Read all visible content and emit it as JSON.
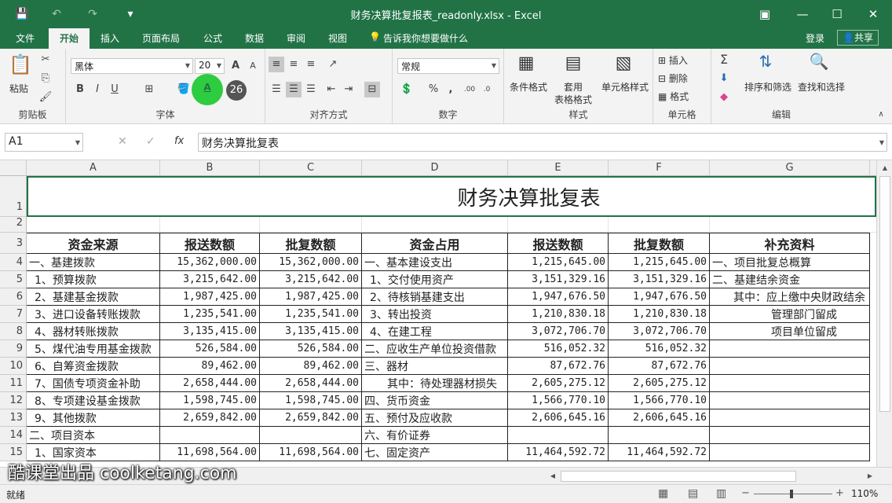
{
  "window": {
    "title": "财务决算批复报表_readonly.xlsx - Excel"
  },
  "qat": {
    "save": "💾",
    "undo": "↶",
    "redo": "↷",
    "custom": "▾"
  },
  "tabs": [
    "文件",
    "开始",
    "插入",
    "页面布局",
    "公式",
    "数据",
    "审阅",
    "视图"
  ],
  "tell_me": "告诉我你想要做什么",
  "login": "登录",
  "share": "共享",
  "ribbon": {
    "clipboard": {
      "label": "剪贴板",
      "paste": "粘贴"
    },
    "font": {
      "label": "字体",
      "name": "黑体",
      "size": "20",
      "bold": "B",
      "italic": "I",
      "underline": "U",
      "grow": "A",
      "shrink": "A",
      "highlight": "A",
      "badge": "26"
    },
    "alignment": {
      "label": "对齐方式"
    },
    "number": {
      "label": "数字",
      "format": "常规",
      "percent": "%",
      "comma": ","
    },
    "styles": {
      "label": "样式",
      "conditional": "条件格式",
      "table": "套用",
      "table2": "表格格式",
      "cell": "单元格样式"
    },
    "cells": {
      "label": "单元格",
      "insert": "插入",
      "delete": "删除",
      "format": "格式"
    },
    "editing": {
      "label": "编辑",
      "sort": "排序和筛选",
      "find": "查找和选择",
      "sigma": "Σ"
    }
  },
  "formula": {
    "namebox": "A1",
    "fx": "fx",
    "content": "财务决算批复表"
  },
  "columns": [
    {
      "id": "A",
      "label": "A",
      "header": "资金来源"
    },
    {
      "id": "B",
      "label": "B",
      "header": "报送数额"
    },
    {
      "id": "C",
      "label": "C",
      "header": "批复数额"
    },
    {
      "id": "D",
      "label": "D",
      "header": "资金占用"
    },
    {
      "id": "E",
      "label": "E",
      "header": "报送数额"
    },
    {
      "id": "F",
      "label": "F",
      "header": "批复数额"
    },
    {
      "id": "G",
      "label": "G",
      "header": "补充资料"
    }
  ],
  "sheet_title": "财务决算批复表",
  "row_numbers": [
    "1",
    "2",
    "3",
    "4",
    "5",
    "6",
    "7",
    "8",
    "9",
    "10",
    "11",
    "12",
    "13",
    "14",
    "15"
  ],
  "rows": [
    [
      "一、基建拨款",
      "15,362,000.00",
      "15,362,000.00",
      "一、基本建设支出",
      "1,215,645.00",
      "1,215,645.00",
      "一、项目批复总概算"
    ],
    [
      "1、预算拨款",
      "3,215,642.00",
      "3,215,642.00",
      "1、交付使用资产",
      "3,151,329.16",
      "3,151,329.16",
      "二、基建结余资金"
    ],
    [
      "2、基建基金拨款",
      "1,987,425.00",
      "1,987,425.00",
      "2、待核销基建支出",
      "1,947,676.50",
      "1,947,676.50",
      "其中：应上缴中央财政结余"
    ],
    [
      "3、进口设备转账拨款",
      "1,235,541.00",
      "1,235,541.00",
      "3、转出投资",
      "1,210,830.18",
      "1,210,830.18",
      "管理部门留成"
    ],
    [
      "4、器材转账拨款",
      "3,135,415.00",
      "3,135,415.00",
      "4、在建工程",
      "3,072,706.70",
      "3,072,706.70",
      "项目单位留成"
    ],
    [
      "5、煤代油专用基金拨款",
      "526,584.00",
      "526,584.00",
      "二、应收生产单位投资借款",
      "516,052.32",
      "516,052.32",
      ""
    ],
    [
      "6、自筹资金拨款",
      "89,462.00",
      "89,462.00",
      "三、器材",
      "87,672.76",
      "87,672.76",
      ""
    ],
    [
      "7、国债专项资金补助",
      "2,658,444.00",
      "2,658,444.00",
      "其中：待处理器材损失",
      "2,605,275.12",
      "2,605,275.12",
      ""
    ],
    [
      "8、专项建设基金拨款",
      "1,598,745.00",
      "1,598,745.00",
      "四、货币资金",
      "1,566,770.10",
      "1,566,770.10",
      ""
    ],
    [
      "9、其他拨款",
      "2,659,842.00",
      "2,659,842.00",
      "五、预付及应收款",
      "2,606,645.16",
      "2,606,645.16",
      ""
    ],
    [
      "二、项目资本",
      "",
      "",
      "六、有价证券",
      "",
      "",
      ""
    ],
    [
      "1、国家资本",
      "11,698,564.00",
      "11,698,564.00",
      "七、固定资产",
      "11,464,592.72",
      "11,464,592.72",
      ""
    ]
  ],
  "status": {
    "ready": "就绪",
    "zoom": "110%"
  },
  "watermark": "酷课堂出品 coolketang.com"
}
